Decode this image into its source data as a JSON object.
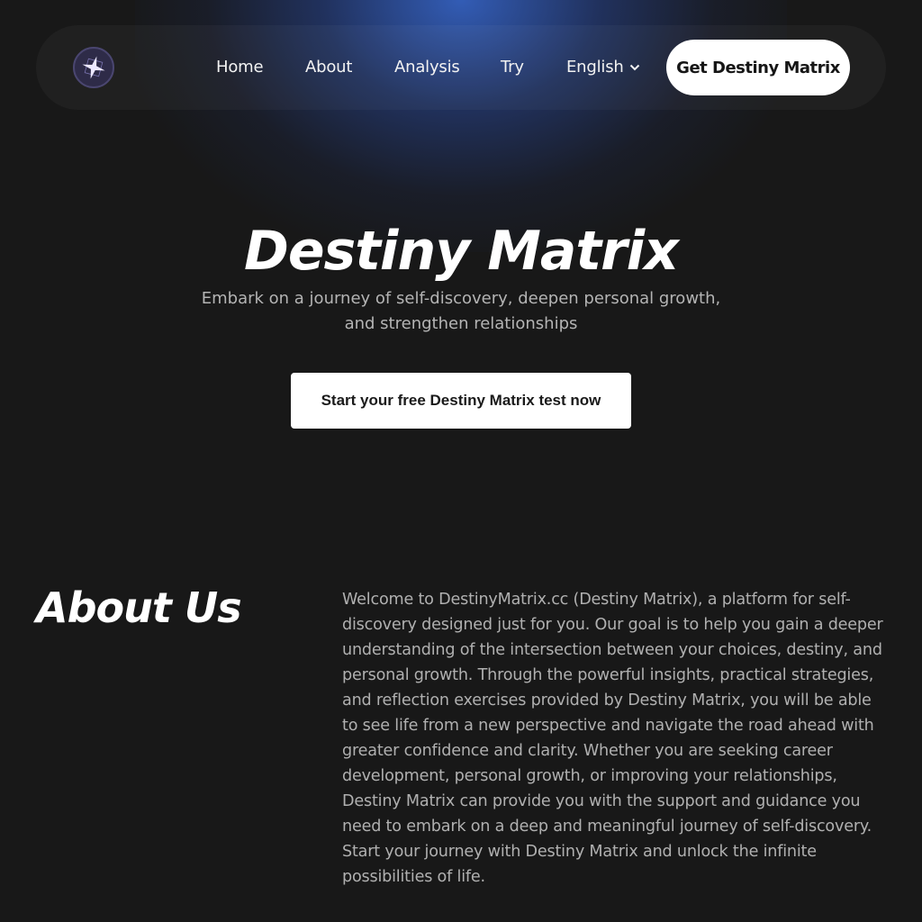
{
  "colors": {
    "background": "#181818",
    "glow": "#3460be",
    "button_bg": "#ffffff",
    "button_text": "#161616",
    "muted_text": "#b4b4b4",
    "logo_star": "#e8e4ff"
  },
  "header": {
    "logo_icon": "star-logo-icon",
    "nav": [
      {
        "label": "Home"
      },
      {
        "label": "About"
      },
      {
        "label": "Analysis"
      },
      {
        "label": "Try"
      }
    ],
    "language": {
      "selected": "English",
      "icon": "chevron-down-icon"
    },
    "cta_label": "Get Destiny Matrix"
  },
  "hero": {
    "title": "Destiny Matrix",
    "subtitle": "Embark on a journey of self-discovery, deepen personal growth, and strengthen relationships",
    "cta_label": "Start your free Destiny Matrix test now"
  },
  "about": {
    "title": "About Us",
    "body": "Welcome to DestinyMatrix.cc (Destiny Matrix), a platform for self-discovery designed just for you. Our goal is to help you gain a deeper understanding of the intersection between your choices, destiny, and personal growth. Through the powerful insights, practical strategies, and reflection exercises provided by Destiny Matrix, you will be able to see life from a new perspective and navigate the road ahead with greater confidence and clarity. Whether you are seeking career development, personal growth, or improving your relationships, Destiny Matrix can provide you with the support and guidance you need to embark on a deep and meaningful journey of self-discovery. Start your journey with Destiny Matrix and unlock the infinite possibilities of life."
  }
}
